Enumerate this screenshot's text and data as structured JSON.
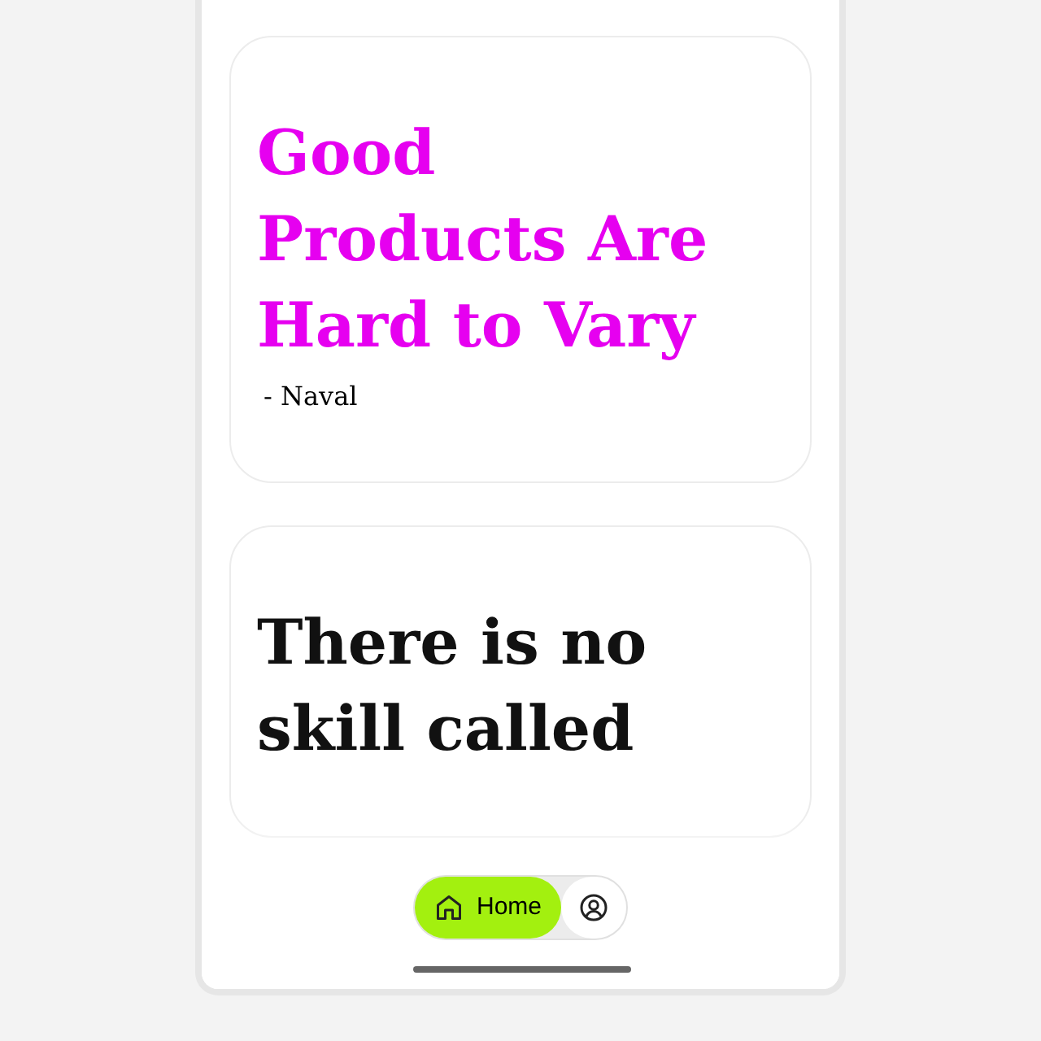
{
  "cards": [
    {
      "quote": "Good Products Are Hard to Vary",
      "author": "- Naval",
      "accent": true
    },
    {
      "quote": "There is no skill called",
      "accent": false
    }
  ],
  "nav": [
    {
      "label": "Home",
      "kind": "home",
      "selected": true
    },
    {
      "kind": "user",
      "selected": false
    }
  ]
}
